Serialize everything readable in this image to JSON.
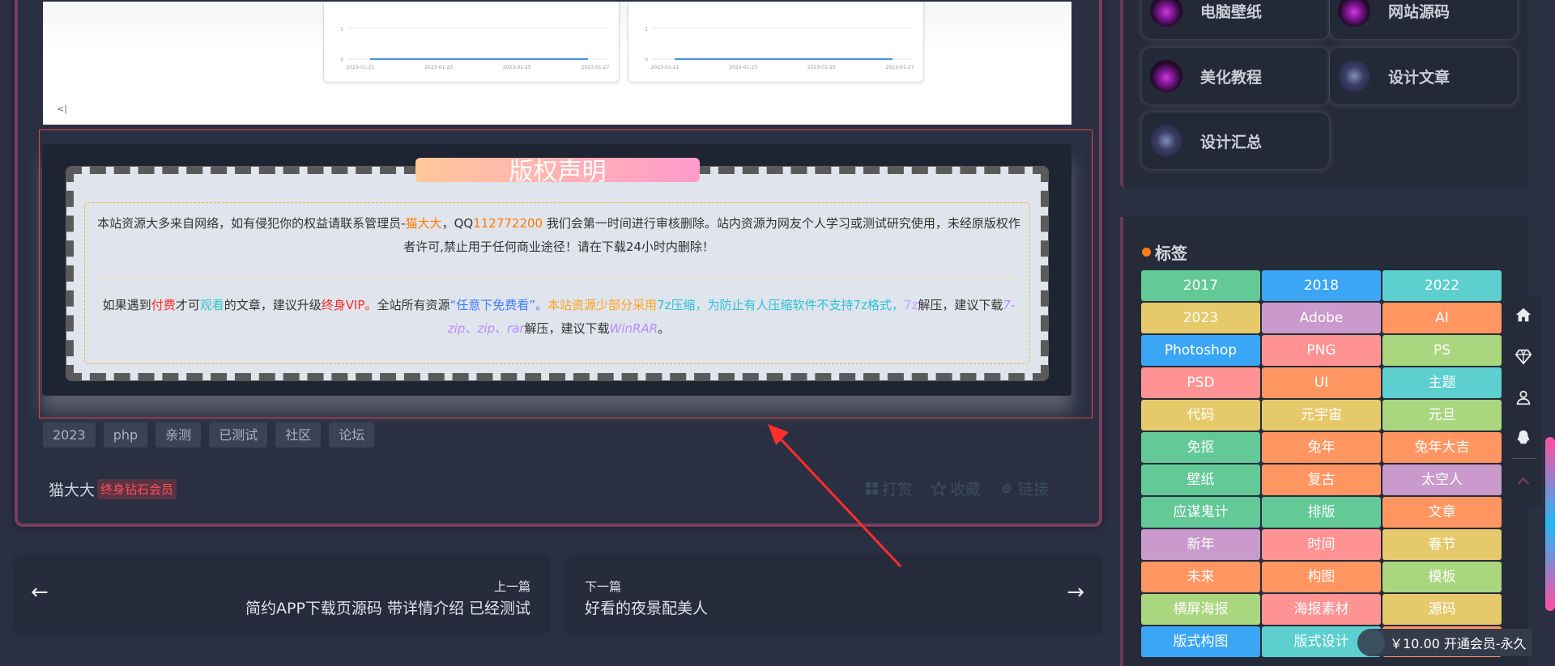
{
  "charts": [
    {
      "y_ticks": [
        "1",
        "0"
      ],
      "x_ticks": [
        "2023-01-21",
        "2023-01-23",
        "2023-01-25",
        "2023-01-27"
      ],
      "series_color": "#4a8fe0"
    },
    {
      "y_ticks": [
        "1",
        "0"
      ],
      "x_ticks": [
        "2023-01-21",
        "2023-01-23",
        "2023-01-25",
        "2023-01-27"
      ],
      "series_color": "#4a8fe0"
    }
  ],
  "collapse_glyph": "<|",
  "copyright": {
    "title": "版权声明",
    "p1": {
      "a": "本站资源大多来自网络，如有侵犯你的权益请联系管理员-",
      "admin": "猫大大",
      "b": "，QQ",
      "qq": "112772200",
      "c": " 我们会第一时间进行审核删除。站内资源为网友个人学习或测试研究使用，未经原版权作者许可,禁止用于任何商业途径！请在下载24小时内删除！"
    },
    "p2": {
      "a": "如果遇到",
      "paid": "付费",
      "b": "才可",
      "watch": "观看",
      "c": "的文章，建议升级",
      "vip": "终身VIP。",
      "d": "全站所有资源",
      "free": "“任意下免费看”。",
      "seven": "本站资源少部分采用",
      "sevenz": "7z压缩，为防止有人压缩软件不支持7z格式，",
      "sevenz2": "7z",
      "e": "解压，建议下载",
      "tools": "7-zip、zip、rar",
      "f": "解压，建议下载",
      "winrar": "WinRAR",
      "g": "。"
    }
  },
  "post_tags": [
    "2023",
    "php",
    "亲测",
    "已测试",
    "社区",
    "论坛"
  ],
  "author": {
    "name": "猫大大",
    "badge": "终身钻石会员"
  },
  "actions": [
    {
      "icon": "qr-icon",
      "label": "打赏"
    },
    {
      "icon": "star-icon",
      "label": "收藏"
    },
    {
      "icon": "link-icon",
      "label": "链接"
    }
  ],
  "nav": {
    "prev": {
      "caption": "上一篇",
      "title": "简约APP下载页源码 带详情介绍 已经测试"
    },
    "next": {
      "caption": "下一篇",
      "title": "好看的夜景配美人"
    }
  },
  "categories": [
    {
      "label": "电脑壁纸",
      "avatar": "purple"
    },
    {
      "label": "网站源码",
      "avatar": "purple"
    },
    {
      "label": "美化教程",
      "avatar": "purple"
    },
    {
      "label": "设计文章",
      "avatar": "alt"
    },
    {
      "label": "设计汇总",
      "avatar": "alt"
    }
  ],
  "tags_panel": {
    "title": "标签",
    "tags": [
      {
        "label": "2017",
        "color": "#62c997"
      },
      {
        "label": "2018",
        "color": "#3aa6f5"
      },
      {
        "label": "2022",
        "color": "#5dcfcf"
      },
      {
        "label": "2023",
        "color": "#e6c96a"
      },
      {
        "label": "Adobe",
        "color": "#c99acb"
      },
      {
        "label": "AI",
        "color": "#ff9560"
      },
      {
        "label": "Photoshop",
        "color": "#3aa6f5"
      },
      {
        "label": "PNG",
        "color": "#ff9393"
      },
      {
        "label": "PS",
        "color": "#a9d67e"
      },
      {
        "label": "PSD",
        "color": "#ff9393"
      },
      {
        "label": "UI",
        "color": "#ff9560"
      },
      {
        "label": "主题",
        "color": "#5dcfcf"
      },
      {
        "label": "代码",
        "color": "#e6c96a"
      },
      {
        "label": "元宇宙",
        "color": "#e6c96a"
      },
      {
        "label": "元旦",
        "color": "#a9d67e"
      },
      {
        "label": "免抠",
        "color": "#62c997"
      },
      {
        "label": "兔年",
        "color": "#ff9560"
      },
      {
        "label": "兔年大吉",
        "color": "#ff9560"
      },
      {
        "label": "壁纸",
        "color": "#62c997"
      },
      {
        "label": "复古",
        "color": "#ff9560"
      },
      {
        "label": "太空人",
        "color": "#c99acb"
      },
      {
        "label": "应谋鬼计",
        "color": "#62c997"
      },
      {
        "label": "排版",
        "color": "#62c997"
      },
      {
        "label": "文章",
        "color": "#ff9560"
      },
      {
        "label": "新年",
        "color": "#c99acb"
      },
      {
        "label": "时间",
        "color": "#ff9393"
      },
      {
        "label": "春节",
        "color": "#e6c96a"
      },
      {
        "label": "未来",
        "color": "#ff9560"
      },
      {
        "label": "构图",
        "color": "#ff9560"
      },
      {
        "label": "模板",
        "color": "#a9d67e"
      },
      {
        "label": "横屏海报",
        "color": "#a9d67e"
      },
      {
        "label": "海报素材",
        "color": "#ff9393"
      },
      {
        "label": "源码",
        "color": "#e6c96a"
      },
      {
        "label": "版式构图",
        "color": "#3aa6f5"
      },
      {
        "label": "版式设计",
        "color": "#5dcfcf"
      },
      {
        "label": "",
        "color": "#ff9560"
      }
    ]
  },
  "float_toolbar": [
    "home-icon",
    "diamond-icon",
    "user-icon",
    "qq-icon",
    "chevron-up-icon"
  ],
  "vip_strip": {
    "price": "￥10.00",
    "label": "开通会员-永久"
  }
}
